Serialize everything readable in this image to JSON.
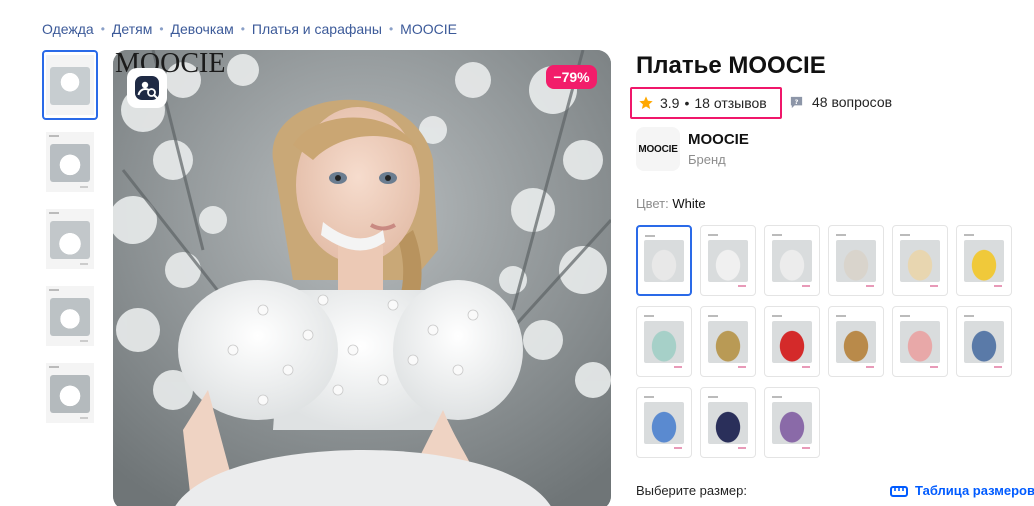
{
  "breadcrumb": [
    "Одежда",
    "Детям",
    "Девочкам",
    "Платья и сарафаны",
    "MOOCIE"
  ],
  "gallery": {
    "overlay_brand": "MOOCIE",
    "discount": "−79%",
    "thumbnails": [
      {
        "color": "#dcdcdc"
      },
      {
        "color": "#c9c9c9"
      },
      {
        "color": "#d3d3d3"
      },
      {
        "color": "#cfcfcf"
      },
      {
        "color": "#c6c6c6"
      }
    ]
  },
  "product": {
    "title": "Платье MOOCIE",
    "rating": "3.9",
    "reviews": "18 отзывов",
    "questions": "48 вопросов",
    "brand_logo": "MOOCIE",
    "brand_name": "MOOCIE",
    "brand_label": "Бренд",
    "color_label": "Цвет:",
    "color_value": "White",
    "size_prompt": "Выберите размер:",
    "size_table": "Таблица размеров"
  },
  "swatches": [
    {
      "color": "#e8e8e8"
    },
    {
      "color": "#f0f0f0"
    },
    {
      "color": "#ececec"
    },
    {
      "color": "#d9d4cc"
    },
    {
      "color": "#e8d6b0"
    },
    {
      "color": "#f0c93a"
    },
    {
      "color": "#a6d0c8"
    },
    {
      "color": "#b99a55"
    },
    {
      "color": "#d42a2a"
    },
    {
      "color": "#b98a4a"
    },
    {
      "color": "#e8a8a8"
    },
    {
      "color": "#5a7aa8"
    },
    {
      "color": "#5a8ad0"
    },
    {
      "color": "#2a2f5a"
    },
    {
      "color": "#8a6aa8"
    }
  ],
  "colors": {
    "accent": "#005bff",
    "discount": "#f21d6a",
    "highlight": "#f0176a",
    "star": "#ffa800"
  },
  "icons": {
    "zoom": "image-search-icon",
    "star": "star-icon",
    "questions": "question-bubble-icon",
    "ruler": "ruler-icon"
  }
}
